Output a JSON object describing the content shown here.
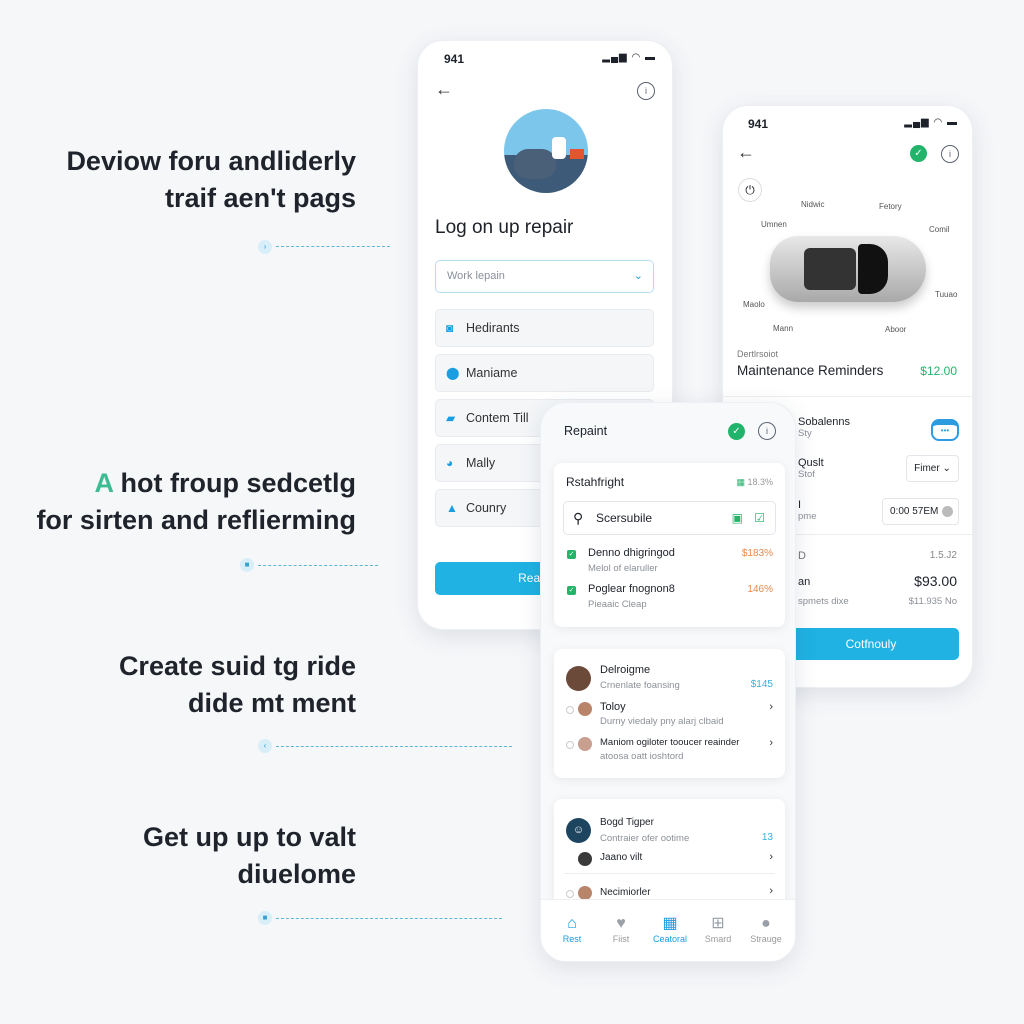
{
  "headlines": [
    {
      "line1": "Deviow foru andliderly",
      "line2": "traif aen't pags"
    },
    {
      "accent": "A",
      "line1": "hot froup sedcetlg",
      "line2": "for sirten and reflierming"
    },
    {
      "line1": "Create suid tg ride",
      "line2": "dide mt ment"
    },
    {
      "line1": "Get up up to valt",
      "line2": "diuelome"
    }
  ],
  "colors": {
    "accent": "#1fb2e2",
    "green": "#22b46a",
    "orange": "#e8894a"
  },
  "phone_left": {
    "time": "941",
    "title": "Log on up repair",
    "select_placeholder": "Work lepain",
    "fields": [
      {
        "label": "Hedirants",
        "icon": "tag-icon"
      },
      {
        "label": "Maniame",
        "icon": "location-pin-icon"
      },
      {
        "label": "Contem Till",
        "icon": "folder-icon"
      },
      {
        "label": "Mally",
        "icon": "chart-icon"
      },
      {
        "label": "Counry",
        "icon": "user-icon"
      }
    ],
    "button": "Real Dein"
  },
  "phone_right": {
    "time": "941",
    "car_labels": [
      "Nidwic",
      "Fetory",
      "Umnen",
      "Comil",
      "Maolo",
      "Tuuao",
      "Mann",
      "Aboor"
    ],
    "overline": "Dertlrsoiot",
    "title": "Maintenance Reminders",
    "price": "$12.00",
    "rows": [
      {
        "title": "Sobalenns",
        "sub": "Sty"
      },
      {
        "title": "Quslt",
        "sub": "Stof",
        "select": "Fimer"
      },
      {
        "title": "I",
        "sub": "pme",
        "input": "0:00 57EM"
      },
      {
        "title": "D",
        "value": "1.5.J2"
      },
      {
        "title": "an",
        "value": "$93.00",
        "sub": "spmets dixe",
        "subvalue": "$11.935 No"
      }
    ],
    "button": "Cotfnouly"
  },
  "phone_center": {
    "title": "Repaint",
    "card1": {
      "title": "Rstahfright",
      "stat": "18.3%",
      "search": "Scersubile",
      "items": [
        {
          "title": "Denno dhigringod",
          "sub": "Melol of elaruller",
          "value": "$183%"
        },
        {
          "title": "Poglear fnognon8",
          "sub": "Pieaaic Cleap",
          "value": "146%"
        }
      ]
    },
    "card2": {
      "title": "Delroigme",
      "sub": "Crnenlate foansing",
      "value": "$145",
      "items": [
        {
          "title": "Toloy",
          "sub": "Durny viedaly pny alarj clbaid"
        },
        {
          "title": "Maniom ogiloter tooucer reainder",
          "sub": "atoosa oatt ioshtord"
        }
      ]
    },
    "card3": {
      "title": "Bogd Tigper",
      "sub": "Contraier ofer ootime",
      "value": "13",
      "items": [
        {
          "title": "Jaano vilt"
        },
        {
          "title": "Necimiorler"
        }
      ]
    },
    "nav": [
      {
        "label": "Rest",
        "icon": "home-icon",
        "active": true
      },
      {
        "label": "Fiist",
        "icon": "heart-icon"
      },
      {
        "label": "Ceatoral",
        "icon": "calendar-icon",
        "active": true
      },
      {
        "label": "Smard",
        "icon": "grid-icon"
      },
      {
        "label": "Strauge",
        "icon": "profile-icon"
      }
    ]
  }
}
